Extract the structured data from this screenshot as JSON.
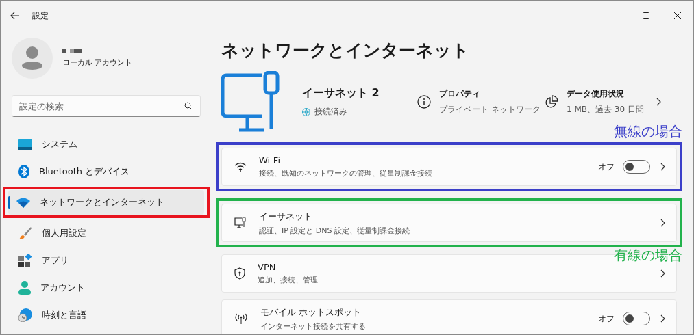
{
  "window": {
    "title": "設定"
  },
  "user": {
    "account_type": "ローカル アカウント"
  },
  "search": {
    "placeholder": "設定の検索"
  },
  "sidebar": {
    "items": [
      {
        "kind": "system",
        "label": "システム",
        "selected": false
      },
      {
        "kind": "bluetooth",
        "label": "Bluetooth とデバイス",
        "selected": false
      },
      {
        "kind": "network",
        "label": "ネットワークとインターネット",
        "selected": true,
        "highlight": {
          "color": "#e8141e"
        }
      },
      {
        "kind": "personalize",
        "label": "個人用設定",
        "selected": false
      },
      {
        "kind": "apps",
        "label": "アプリ",
        "selected": false
      },
      {
        "kind": "account",
        "label": "アカウント",
        "selected": false
      },
      {
        "kind": "time",
        "label": "時刻と言語",
        "selected": false
      }
    ]
  },
  "page_title": "ネットワークとインターネット",
  "connection": {
    "name": "イーサネット 2",
    "status": "接続済み"
  },
  "properties": {
    "label": "プロパティ",
    "value": "プライベート ネットワーク"
  },
  "data_usage": {
    "label": "データ使用状況",
    "value": "1 MB、過去 30 日間"
  },
  "settings": [
    {
      "kind": "wifi",
      "title": "Wi-Fi",
      "subtitle": "接続、既知のネットワークの管理、従量制課金接続",
      "toggle": {
        "label": "オフ",
        "on": false
      },
      "annotation": {
        "label": "無線の場合",
        "color": "#3b3fc9",
        "label_above": true
      }
    },
    {
      "kind": "ethernet",
      "title": "イーサネット",
      "subtitle": "認証、IP 設定と DNS 設定、従量制課金接続",
      "annotation": {
        "label": "有線の場合",
        "color": "#22b24c",
        "label_above": false
      }
    },
    {
      "kind": "vpn",
      "title": "VPN",
      "subtitle": "追加、接続、管理"
    },
    {
      "kind": "hotspot",
      "title": "モバイル ホットスポット",
      "subtitle": "インターネット接続を共有する",
      "toggle": {
        "label": "オフ",
        "on": false
      }
    }
  ]
}
